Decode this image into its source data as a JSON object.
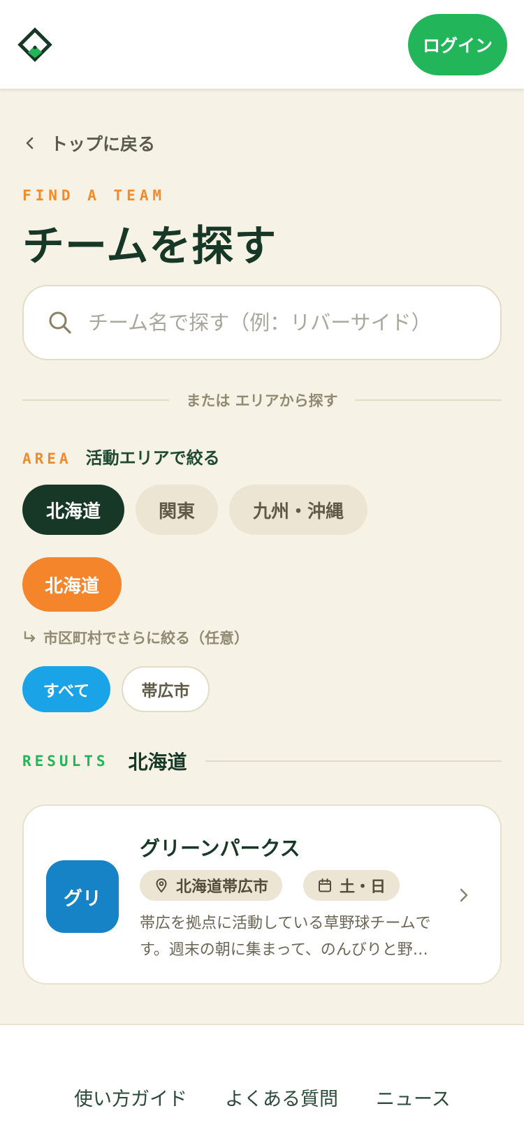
{
  "header": {
    "login_label": "ログイン"
  },
  "nav": {
    "back_label": "トップに戻る"
  },
  "page": {
    "eyebrow": "FIND A TEAM",
    "title": "チームを探す"
  },
  "search": {
    "placeholder": "チーム名で探す（例：リバーサイド）"
  },
  "divider": {
    "label": "または エリアから探す"
  },
  "area": {
    "tag": "AREA",
    "label": "活動エリアで絞る",
    "regions": [
      "北海道",
      "関東",
      "九州・沖縄"
    ],
    "selected": "北海道"
  },
  "city": {
    "label": "市区町村でさらに絞る（任意）",
    "options": [
      "すべて",
      "帯広市"
    ]
  },
  "results": {
    "tag": "RESULTS",
    "region": "北海道",
    "teams": [
      {
        "avatar": "グリ",
        "name": "グリーンパークス",
        "location": "北海道帯広市",
        "days": "土・日",
        "description": "帯広を拠点に活動している草野球チームです。週末の朝に集まって、のんびりと野球を楽しんでいます。"
      }
    ]
  },
  "footer": {
    "links": [
      "使い方ガイド",
      "よくある質問",
      "ニュース"
    ]
  },
  "colors": {
    "brand": "#23b55a",
    "accent": "#f5852b",
    "dark": "#173826",
    "info": "#1ba3e8"
  },
  "icons": {
    "logo": "diamond-logo-icon",
    "back": "chevron-left-icon",
    "search": "search-icon",
    "pin": "location-pin-icon",
    "calendar": "calendar-icon",
    "next": "chevron-right-icon",
    "sub": "return-arrow-icon"
  }
}
